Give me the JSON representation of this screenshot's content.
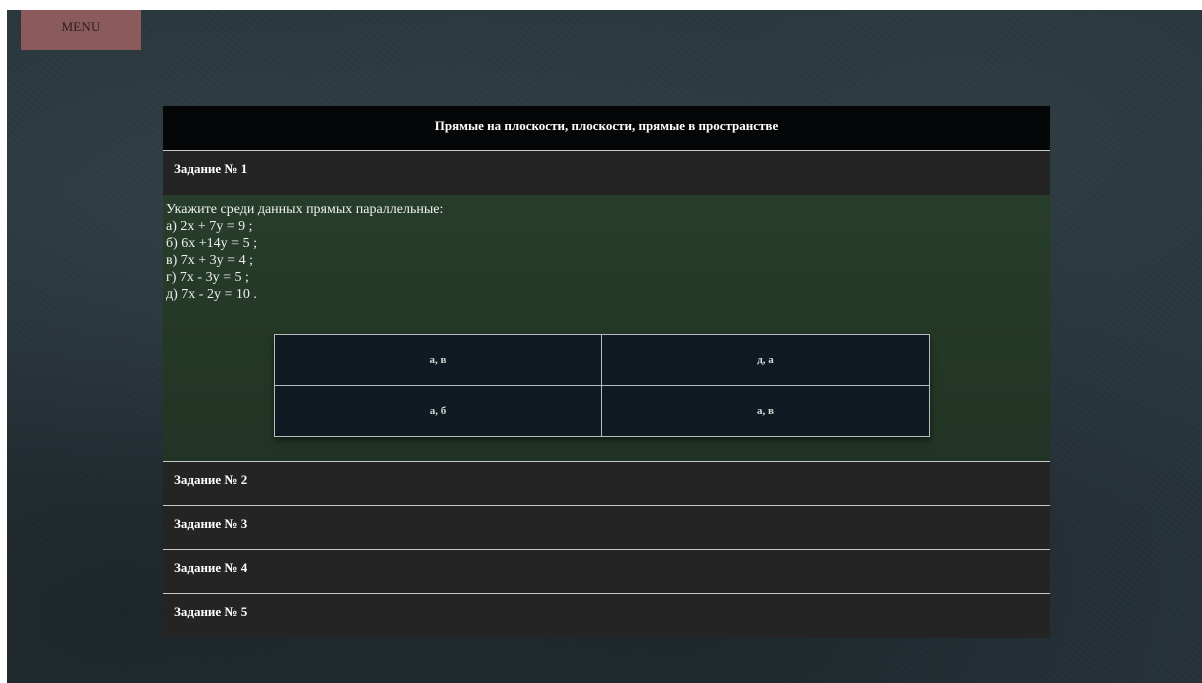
{
  "menu": {
    "label": "MENU"
  },
  "quiz": {
    "title": "Прямые на плоскости, плоскости, прямые в пространстве",
    "tasks": [
      {
        "label": "Задание № 1"
      },
      {
        "label": "Задание № 2"
      },
      {
        "label": "Задание № 3"
      },
      {
        "label": "Задание № 4"
      },
      {
        "label": "Задание № 5"
      }
    ],
    "question": {
      "prompt": "Укажите среди данных прямых параллельные:",
      "lines": [
        "а) 2x + 7y = 9 ;",
        "б) 6x +14y = 5 ;",
        "в) 7x + 3y = 4 ;",
        "г) 7x - 3y = 5 ;",
        "д) 7x - 2y = 10 ."
      ]
    },
    "answers": [
      "а, в",
      "д, а",
      "а, б",
      "а, в"
    ]
  }
}
